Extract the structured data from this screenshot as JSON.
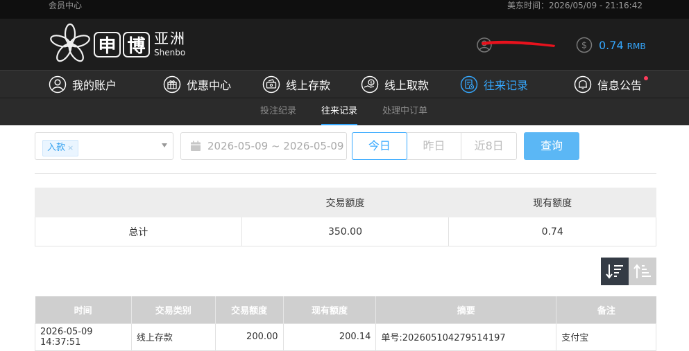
{
  "topbar": {
    "member_center": "会员中心",
    "time_text": "美东时间：2026/05/09 - 21:16:42"
  },
  "logo": {
    "char1": "申",
    "char2": "博",
    "brand_cn": "亚洲",
    "brand_en": "Shenbo"
  },
  "balance": {
    "amount": "0.74",
    "currency": "RMB"
  },
  "nav": [
    {
      "label": "我的账户"
    },
    {
      "label": "优惠中心"
    },
    {
      "label": "线上存款"
    },
    {
      "label": "线上取款"
    },
    {
      "label": "往来记录"
    },
    {
      "label": "信息公告"
    }
  ],
  "subnav": [
    {
      "label": "投注纪录"
    },
    {
      "label": "往来记录"
    },
    {
      "label": "处理中订单"
    }
  ],
  "filters": {
    "type_tag": "入款",
    "date_range": "2026-05-09 ~ 2026-05-09",
    "today": "今日",
    "yesterday": "昨日",
    "last8": "近8日",
    "query": "查询"
  },
  "summary": {
    "headers": [
      "",
      "交易额度",
      "现有额度"
    ],
    "row": [
      "总计",
      "350.00",
      "0.74"
    ]
  },
  "detail": {
    "headers": [
      "时间",
      "交易类别",
      "交易额度",
      "现有额度",
      "摘要",
      "备注"
    ],
    "rows": [
      [
        "2026-05-09 14:37:51",
        "线上存款",
        "200.00",
        "200.14",
        "单号:202605104279514197",
        "支付宝"
      ]
    ]
  },
  "colors": {
    "accent": "#35a8ff",
    "query_button": "#5bb7f5",
    "notify_dot": "#ff3b5b"
  }
}
